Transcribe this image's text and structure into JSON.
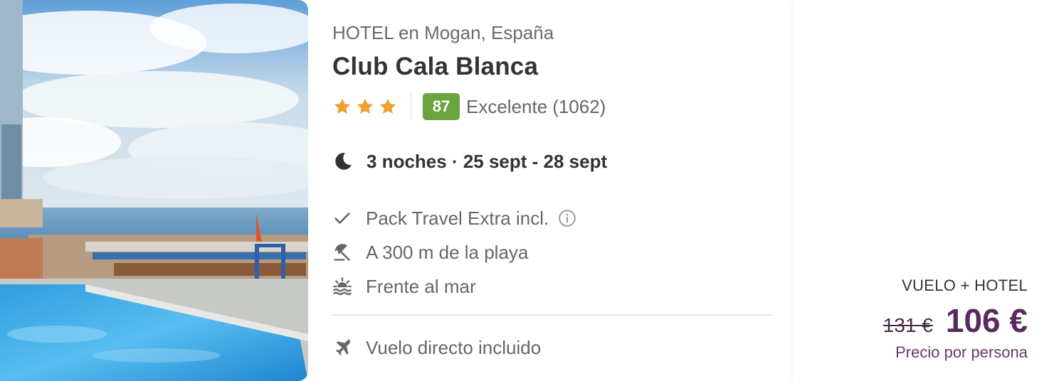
{
  "hotel": {
    "location": "HOTEL en Mogan, España",
    "name": "Club Cala Blanca",
    "stars": 3,
    "score": "87",
    "score_label": "Excelente",
    "review_count": "(1062)"
  },
  "stay": {
    "dates": "3 noches · 25 sept - 28 sept"
  },
  "features": [
    {
      "icon": "check-icon",
      "label": "Pack Travel Extra incl."
    },
    {
      "icon": "beach-umbrella-icon",
      "label": "A 300 m de la playa"
    },
    {
      "icon": "sea-sunset-icon",
      "label": "Frente al mar"
    }
  ],
  "flight": {
    "icon": "plane-icon",
    "label": "Vuelo directo incluido"
  },
  "price": {
    "type": "VUELO + HOTEL",
    "old": "131 €",
    "current": "106 €",
    "note": "Precio por persona"
  },
  "colors": {
    "score_badge": "#6ba33f",
    "star": "#f0a030",
    "price": "#5a2a5e"
  }
}
